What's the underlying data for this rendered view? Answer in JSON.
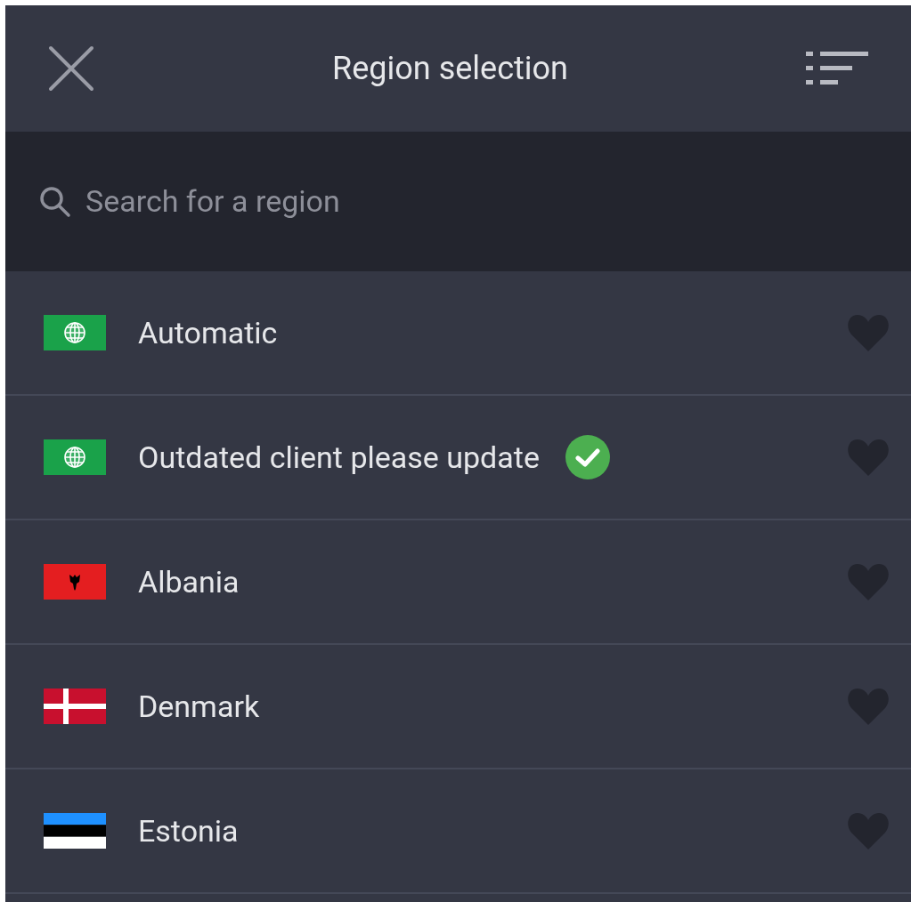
{
  "header": {
    "title": "Region selection"
  },
  "search": {
    "placeholder": "Search for a region"
  },
  "regions": [
    {
      "name": "Automatic",
      "kind": "globe",
      "selected": false,
      "favorite": false
    },
    {
      "name": "Outdated client please update",
      "kind": "globe",
      "selected": true,
      "favorite": false
    },
    {
      "name": "Albania",
      "kind": "albania",
      "selected": false,
      "favorite": false
    },
    {
      "name": "Denmark",
      "kind": "denmark",
      "selected": false,
      "favorite": false
    },
    {
      "name": "Estonia",
      "kind": "estonia",
      "selected": false,
      "favorite": false
    }
  ]
}
